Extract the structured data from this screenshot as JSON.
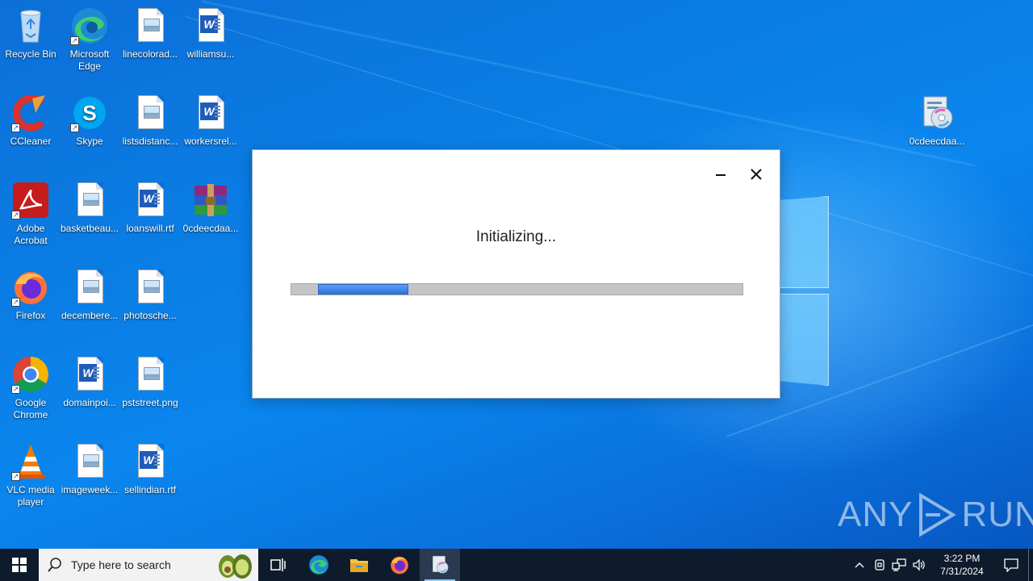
{
  "desktop": {
    "icons": [
      {
        "label": "Recycle Bin",
        "icon": "recycle-bin-icon"
      },
      {
        "label": "Microsoft Edge",
        "icon": "edge-icon"
      },
      {
        "label": "linecolorad...",
        "icon": "image-file-icon"
      },
      {
        "label": "williamsu...",
        "icon": "word-file-icon"
      },
      {
        "label": "CCleaner",
        "icon": "ccleaner-icon"
      },
      {
        "label": "Skype",
        "icon": "skype-icon"
      },
      {
        "label": "listsdistanc...",
        "icon": "image-file-icon"
      },
      {
        "label": "workersrel...",
        "icon": "word-file-icon"
      },
      {
        "label": "Adobe Acrobat",
        "icon": "acrobat-icon"
      },
      {
        "label": "basketbeau...",
        "icon": "image-file-icon"
      },
      {
        "label": "loanswill.rtf",
        "icon": "word-file-icon"
      },
      {
        "label": "0cdeecdaa...",
        "icon": "winrar-icon"
      },
      {
        "label": "Firefox",
        "icon": "firefox-icon"
      },
      {
        "label": "decembere...",
        "icon": "image-file-icon"
      },
      {
        "label": "photosche...",
        "icon": "image-file-icon"
      },
      {
        "label": "Google Chrome",
        "icon": "chrome-icon"
      },
      {
        "label": "domainpoi...",
        "icon": "word-file-icon"
      },
      {
        "label": "pststreet.png",
        "icon": "image-file-icon"
      },
      {
        "label": "VLC media player",
        "icon": "vlc-icon"
      },
      {
        "label": "imageweek...",
        "icon": "image-file-icon"
      },
      {
        "label": "sellindian.rtf",
        "icon": "word-file-icon"
      },
      {
        "label": "0cdeecdaa...",
        "icon": "installer-icon"
      }
    ]
  },
  "dialog": {
    "status": "Initializing...",
    "progress_percent": 20
  },
  "watermark": {
    "left": "ANY",
    "right": "RUN"
  },
  "taskbar": {
    "search_placeholder": "Type here to search",
    "pinned": [
      "task-view-icon",
      "edge-icon",
      "file-explorer-icon",
      "firefox-icon",
      "installer-icon"
    ],
    "clock_time": "3:22 PM",
    "clock_date": "7/31/2024"
  }
}
